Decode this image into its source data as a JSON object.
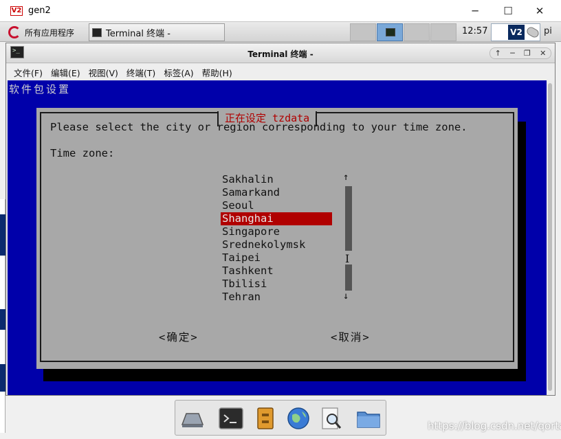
{
  "window": {
    "title": "gen2",
    "logo_text": "V2",
    "controls": {
      "minimize": "─",
      "maximize": "☐",
      "close": "✕"
    }
  },
  "panel": {
    "apps_menu_label": "所有应用程序",
    "task_label": "Terminal 终端 -",
    "clock": "12:57",
    "vnc_logo": "V2",
    "user": "pi"
  },
  "terminal": {
    "title": "Terminal 终端 -",
    "controls": {
      "up": "↑",
      "minimize": "─",
      "restore": "❐",
      "close": "✕"
    },
    "menu": [
      "文件(F)",
      "编辑(E)",
      "视图(V)",
      "终端(T)",
      "标签(A)",
      "帮助(H)"
    ],
    "header": "软件包设置"
  },
  "dialog": {
    "title": "正在设定 tzdata",
    "prompt": "Please select the city or region corresponding to your time zone.",
    "label": "Time zone:",
    "items": [
      "Sakhalin",
      "Samarkand",
      "Seoul",
      "Shanghai",
      "Singapore",
      "Srednekolymsk",
      "Taipei",
      "Tashkent",
      "Tbilisi",
      "Tehran"
    ],
    "selected": "Shanghai",
    "scroll_up": "↑",
    "scroll_down": "↓",
    "ok": "<确定>",
    "cancel": "<取消>"
  },
  "watermark": "https://blog.csdn.net/qortal",
  "colors": {
    "terminal_bg": "#0000aa",
    "dialog_bg": "#a8a8a8",
    "accent": "#b00000"
  },
  "icons": [
    "debian-logo-icon",
    "terminal-icon",
    "file-manager-icon",
    "archive-icon",
    "globe-icon",
    "search-icon",
    "folder-icon"
  ]
}
